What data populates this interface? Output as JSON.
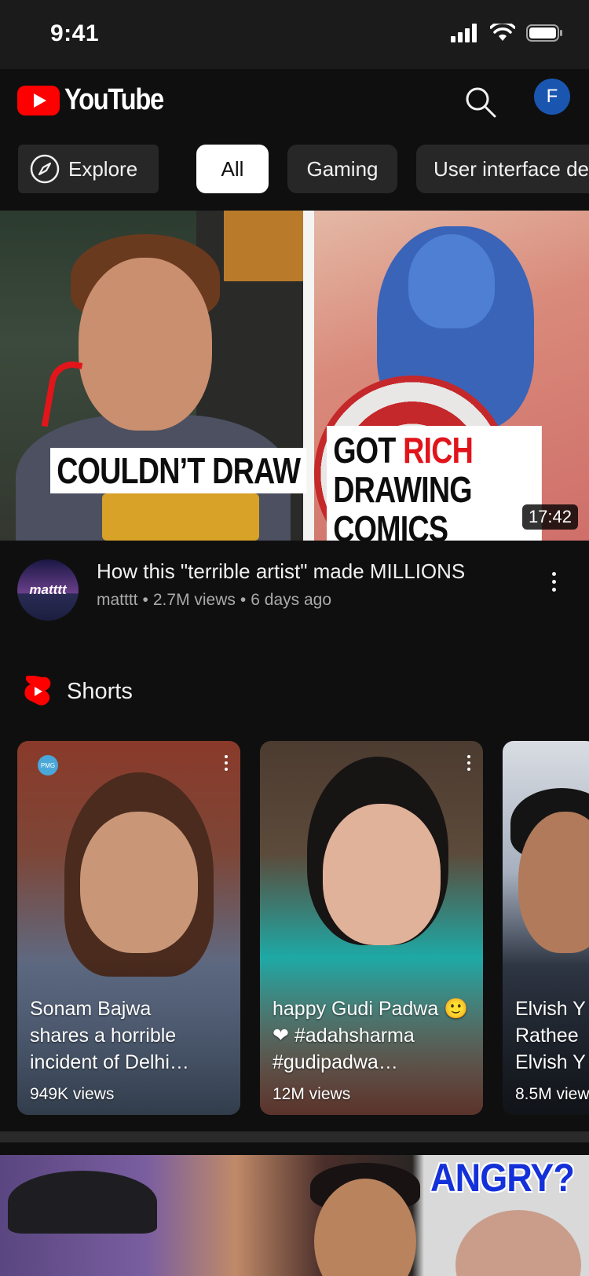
{
  "status_bar": {
    "time": "9:41"
  },
  "header": {
    "logo_text": "YouTube",
    "avatar_letter": "F"
  },
  "chips": {
    "explore": "Explore",
    "all": "All",
    "gaming": "Gaming",
    "ui": "User interface de"
  },
  "hero": {
    "caption_left": "COULDN’T DRAW",
    "caption_right_line1_a": "GOT ",
    "caption_right_line1_b": "RICH",
    "caption_right_line2": "DRAWING COMICS",
    "duration": "17:42",
    "channel_avatar_text": "matttt",
    "title": "How this \"terrible artist\" made MILLIONS",
    "channel": "matttt",
    "views": "2.7M views",
    "age": "6 days ago"
  },
  "shorts": {
    "section_title": "Shorts",
    "items": [
      {
        "title": "Sonam Bajwa\nshares a horrible\nincident of Delhi…",
        "views": "949K views"
      },
      {
        "title": "happy Gudi Padwa 🙂\n❤ #adahsharma\n#gudipadwa…",
        "views": "12M views"
      },
      {
        "title": "Elvish Y\nRathee\nElvish Y",
        "views": "8.5M view"
      }
    ]
  },
  "bottom_thumb": {
    "overlay_text": "ANGRY?"
  },
  "colors": {
    "background": "#0f0f0f",
    "youtube_red": "#ff0000",
    "chip_bg": "#272727",
    "chip_active_bg": "#ffffff",
    "secondary_text": "#aaaaaa",
    "avatar_blue": "#1a56b0"
  },
  "icons": [
    "signal-icon",
    "wifi-icon",
    "battery-icon",
    "youtube-logo-icon",
    "search-icon",
    "compass-icon",
    "kebab-menu-icon",
    "shorts-logo-icon"
  ]
}
